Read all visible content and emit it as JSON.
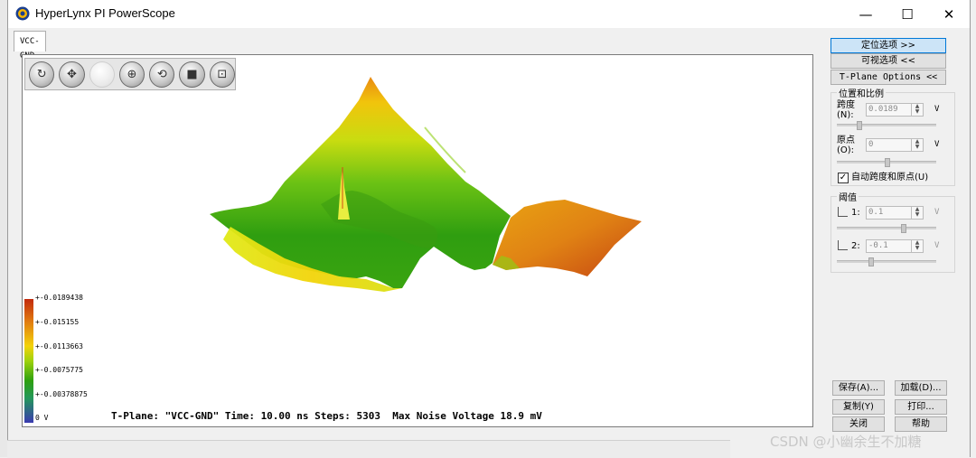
{
  "window": {
    "title": "HyperLynx PI PowerScope",
    "controls": {
      "minimize": "—",
      "maximize": "☐",
      "close": "✕"
    }
  },
  "tabs": [
    {
      "label": "VCC-GND"
    }
  ],
  "toolbar": {
    "tools": [
      {
        "icon": "rotate-arrows-icon",
        "glyph": "↻"
      },
      {
        "icon": "pan-arrows-icon",
        "glyph": "✥"
      },
      {
        "icon": "blank-tool-icon",
        "glyph": ""
      },
      {
        "icon": "crosshair-move-icon",
        "glyph": "⊕"
      },
      {
        "icon": "spin-icon",
        "glyph": "⟲"
      },
      {
        "icon": "stop-icon",
        "glyph": "■"
      },
      {
        "icon": "fit-view-icon",
        "glyph": "⊡"
      }
    ]
  },
  "legend": {
    "labels": [
      "+-0.0189438",
      "+-0.015155",
      "+-0.0113663",
      "+-0.0075775",
      "+-0.00378875",
      "0 V"
    ],
    "colors": {
      "top": "#c22a0d",
      "high": "#e07a10",
      "mid": "#f3d30a",
      "midlow": "#2ea00f",
      "low": "#24985a",
      "bottom": "#3a3ab0"
    }
  },
  "status_line": "T-Plane: \"VCC-GND\" Time: 10.00 ns Steps: 5303  Max Noise Voltage 18.9 mV",
  "side_panel": {
    "locate_options_btn": "定位选项 >>",
    "visual_options_btn": "可视选项 <<",
    "tplane_options_btn": "T-Plane Options <<",
    "position_scale": {
      "title": "位置和比例",
      "span_label": "跨度",
      "span_hotkey": "(N):",
      "span_value": "0.0189",
      "span_unit": "V",
      "origin_label": "原点",
      "origin_hotkey": "(O):",
      "origin_value": "0",
      "origin_unit": "V",
      "auto_label": "自动跨度和原点(U)",
      "auto_checked": "✓"
    },
    "threshold": {
      "title": "阈值",
      "t1_label": "1:",
      "t1_value": "0.1",
      "t1_unit": "V",
      "t2_label": "2:",
      "t2_value": "-0.1",
      "t2_unit": "V"
    },
    "buttons": {
      "save": "保存(A)...",
      "load": "加载(D)...",
      "copy": "复制(Y)",
      "print": "打印...",
      "close": "关闭",
      "help": "帮助"
    }
  },
  "watermark": "CSDN @小幽余生不加糖"
}
